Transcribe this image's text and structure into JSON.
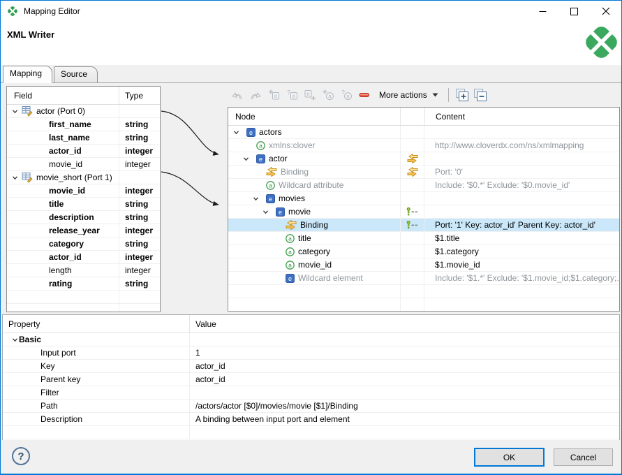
{
  "window": {
    "title": "Mapping Editor"
  },
  "header": {
    "title": "XML Writer",
    "logo": "cloverdx-clover-logo"
  },
  "tabs": [
    {
      "label": "Mapping",
      "active": true
    },
    {
      "label": "Source",
      "active": false
    }
  ],
  "field_panel": {
    "columns": [
      "Field",
      "Type"
    ],
    "rows": [
      {
        "kind": "group",
        "label": "actor (Port 0)",
        "type": ""
      },
      {
        "kind": "field",
        "label": "first_name",
        "type": "string",
        "bold": true
      },
      {
        "kind": "field",
        "label": "last_name",
        "type": "string",
        "bold": true
      },
      {
        "kind": "field",
        "label": "actor_id",
        "type": "integer",
        "bold": true
      },
      {
        "kind": "field",
        "label": "movie_id",
        "type": "integer",
        "bold": false
      },
      {
        "kind": "group",
        "label": "movie_short (Port 1)",
        "type": ""
      },
      {
        "kind": "field",
        "label": "movie_id",
        "type": "integer",
        "bold": true
      },
      {
        "kind": "field",
        "label": "title",
        "type": "string",
        "bold": true
      },
      {
        "kind": "field",
        "label": "description",
        "type": "string",
        "bold": true
      },
      {
        "kind": "field",
        "label": "release_year",
        "type": "integer",
        "bold": true
      },
      {
        "kind": "field",
        "label": "category",
        "type": "string",
        "bold": true
      },
      {
        "kind": "field",
        "label": "actor_id",
        "type": "integer",
        "bold": true
      },
      {
        "kind": "field",
        "label": "length",
        "type": "integer",
        "bold": false
      },
      {
        "kind": "field",
        "label": "rating",
        "type": "string",
        "bold": true
      },
      {
        "kind": "empty"
      },
      {
        "kind": "empty"
      },
      {
        "kind": "empty"
      }
    ]
  },
  "toolbar": {
    "buttons": [
      {
        "icon": "undo-icon",
        "disabled": true
      },
      {
        "icon": "redo-icon",
        "disabled": true
      },
      {
        "icon": "add-child-element-icon",
        "disabled": true
      },
      {
        "icon": "add-wildcard-element-icon",
        "disabled": true
      },
      {
        "icon": "add-element-icon",
        "disabled": true
      },
      {
        "icon": "add-attribute-icon",
        "disabled": true
      },
      {
        "icon": "add-wildcard-attribute-icon",
        "disabled": true
      },
      {
        "icon": "remove-icon",
        "disabled": false
      }
    ],
    "more_actions_label": "More actions"
  },
  "tree_panel": {
    "columns": [
      "Node",
      "Content"
    ],
    "rows": [
      {
        "level": 0,
        "chevron": true,
        "icon": "element-icon",
        "label": "actors",
        "content": ""
      },
      {
        "level": 1,
        "chevron": false,
        "icon": "attribute-icon",
        "label": "xmlns:clover",
        "gray": true,
        "content": "http://www.cloverdx.com/ns/xmlmapping",
        "content_gray": true
      },
      {
        "level": 1,
        "chevron": true,
        "icon": "element-icon",
        "label": "actor",
        "mid": "binding-arrows-icon",
        "content": ""
      },
      {
        "level": 2,
        "chevron": false,
        "icon": "binding-arrows-icon",
        "label": "Binding",
        "gray": true,
        "mid": "binding-arrows-icon",
        "content": "Port: '0'",
        "content_gray": true
      },
      {
        "level": 2,
        "chevron": false,
        "icon": "attribute-icon",
        "label": "Wildcard attribute",
        "gray": true,
        "content": "Include: '$0.*' Exclude: '$0.movie_id'",
        "content_gray": true
      },
      {
        "level": 2,
        "chevron": true,
        "icon": "element-icon",
        "label": "movies",
        "content": ""
      },
      {
        "level": 3,
        "chevron": true,
        "icon": "element-icon",
        "label": "movie",
        "mid": "key-binding-icon",
        "content": ""
      },
      {
        "level": 4,
        "chevron": false,
        "icon": "binding-arrows-icon",
        "label": "Binding",
        "selected": true,
        "mid": "key-binding-icon",
        "content": "Port: '1' Key: actor_id' Parent Key: actor_id'"
      },
      {
        "level": 4,
        "chevron": false,
        "icon": "attribute-icon",
        "label": "title",
        "content": "$1.title"
      },
      {
        "level": 4,
        "chevron": false,
        "icon": "attribute-icon",
        "label": "category",
        "content": "$1.category"
      },
      {
        "level": 4,
        "chevron": false,
        "icon": "attribute-icon",
        "label": "movie_id",
        "content": "$1.movie_id"
      },
      {
        "level": 4,
        "chevron": false,
        "icon": "element-icon",
        "label": "Wildcard element",
        "gray": true,
        "content": "Include: '$1.*' Exclude: '$1.movie_id;$1.category;...",
        "content_gray": true
      },
      {
        "empty": true
      },
      {
        "empty": true
      },
      {
        "empty": true
      }
    ]
  },
  "property_panel": {
    "columns": [
      "Property",
      "Value"
    ],
    "rows": [
      {
        "kind": "group",
        "label": "Basic",
        "value": ""
      },
      {
        "kind": "prop",
        "label": "Input port",
        "value": "1"
      },
      {
        "kind": "prop",
        "label": "Key",
        "value": "actor_id"
      },
      {
        "kind": "prop",
        "label": "Parent key",
        "value": "actor_id"
      },
      {
        "kind": "prop",
        "label": "Filter",
        "value": ""
      },
      {
        "kind": "prop",
        "label": "Path",
        "value": "/actors/actor [$0]/movies/movie [$1]/Binding"
      },
      {
        "kind": "prop",
        "label": "Description",
        "value": "A binding between input port and element"
      },
      {
        "kind": "empty"
      }
    ]
  },
  "footer": {
    "help_label": "?",
    "ok_label": "OK",
    "cancel_label": "Cancel"
  }
}
